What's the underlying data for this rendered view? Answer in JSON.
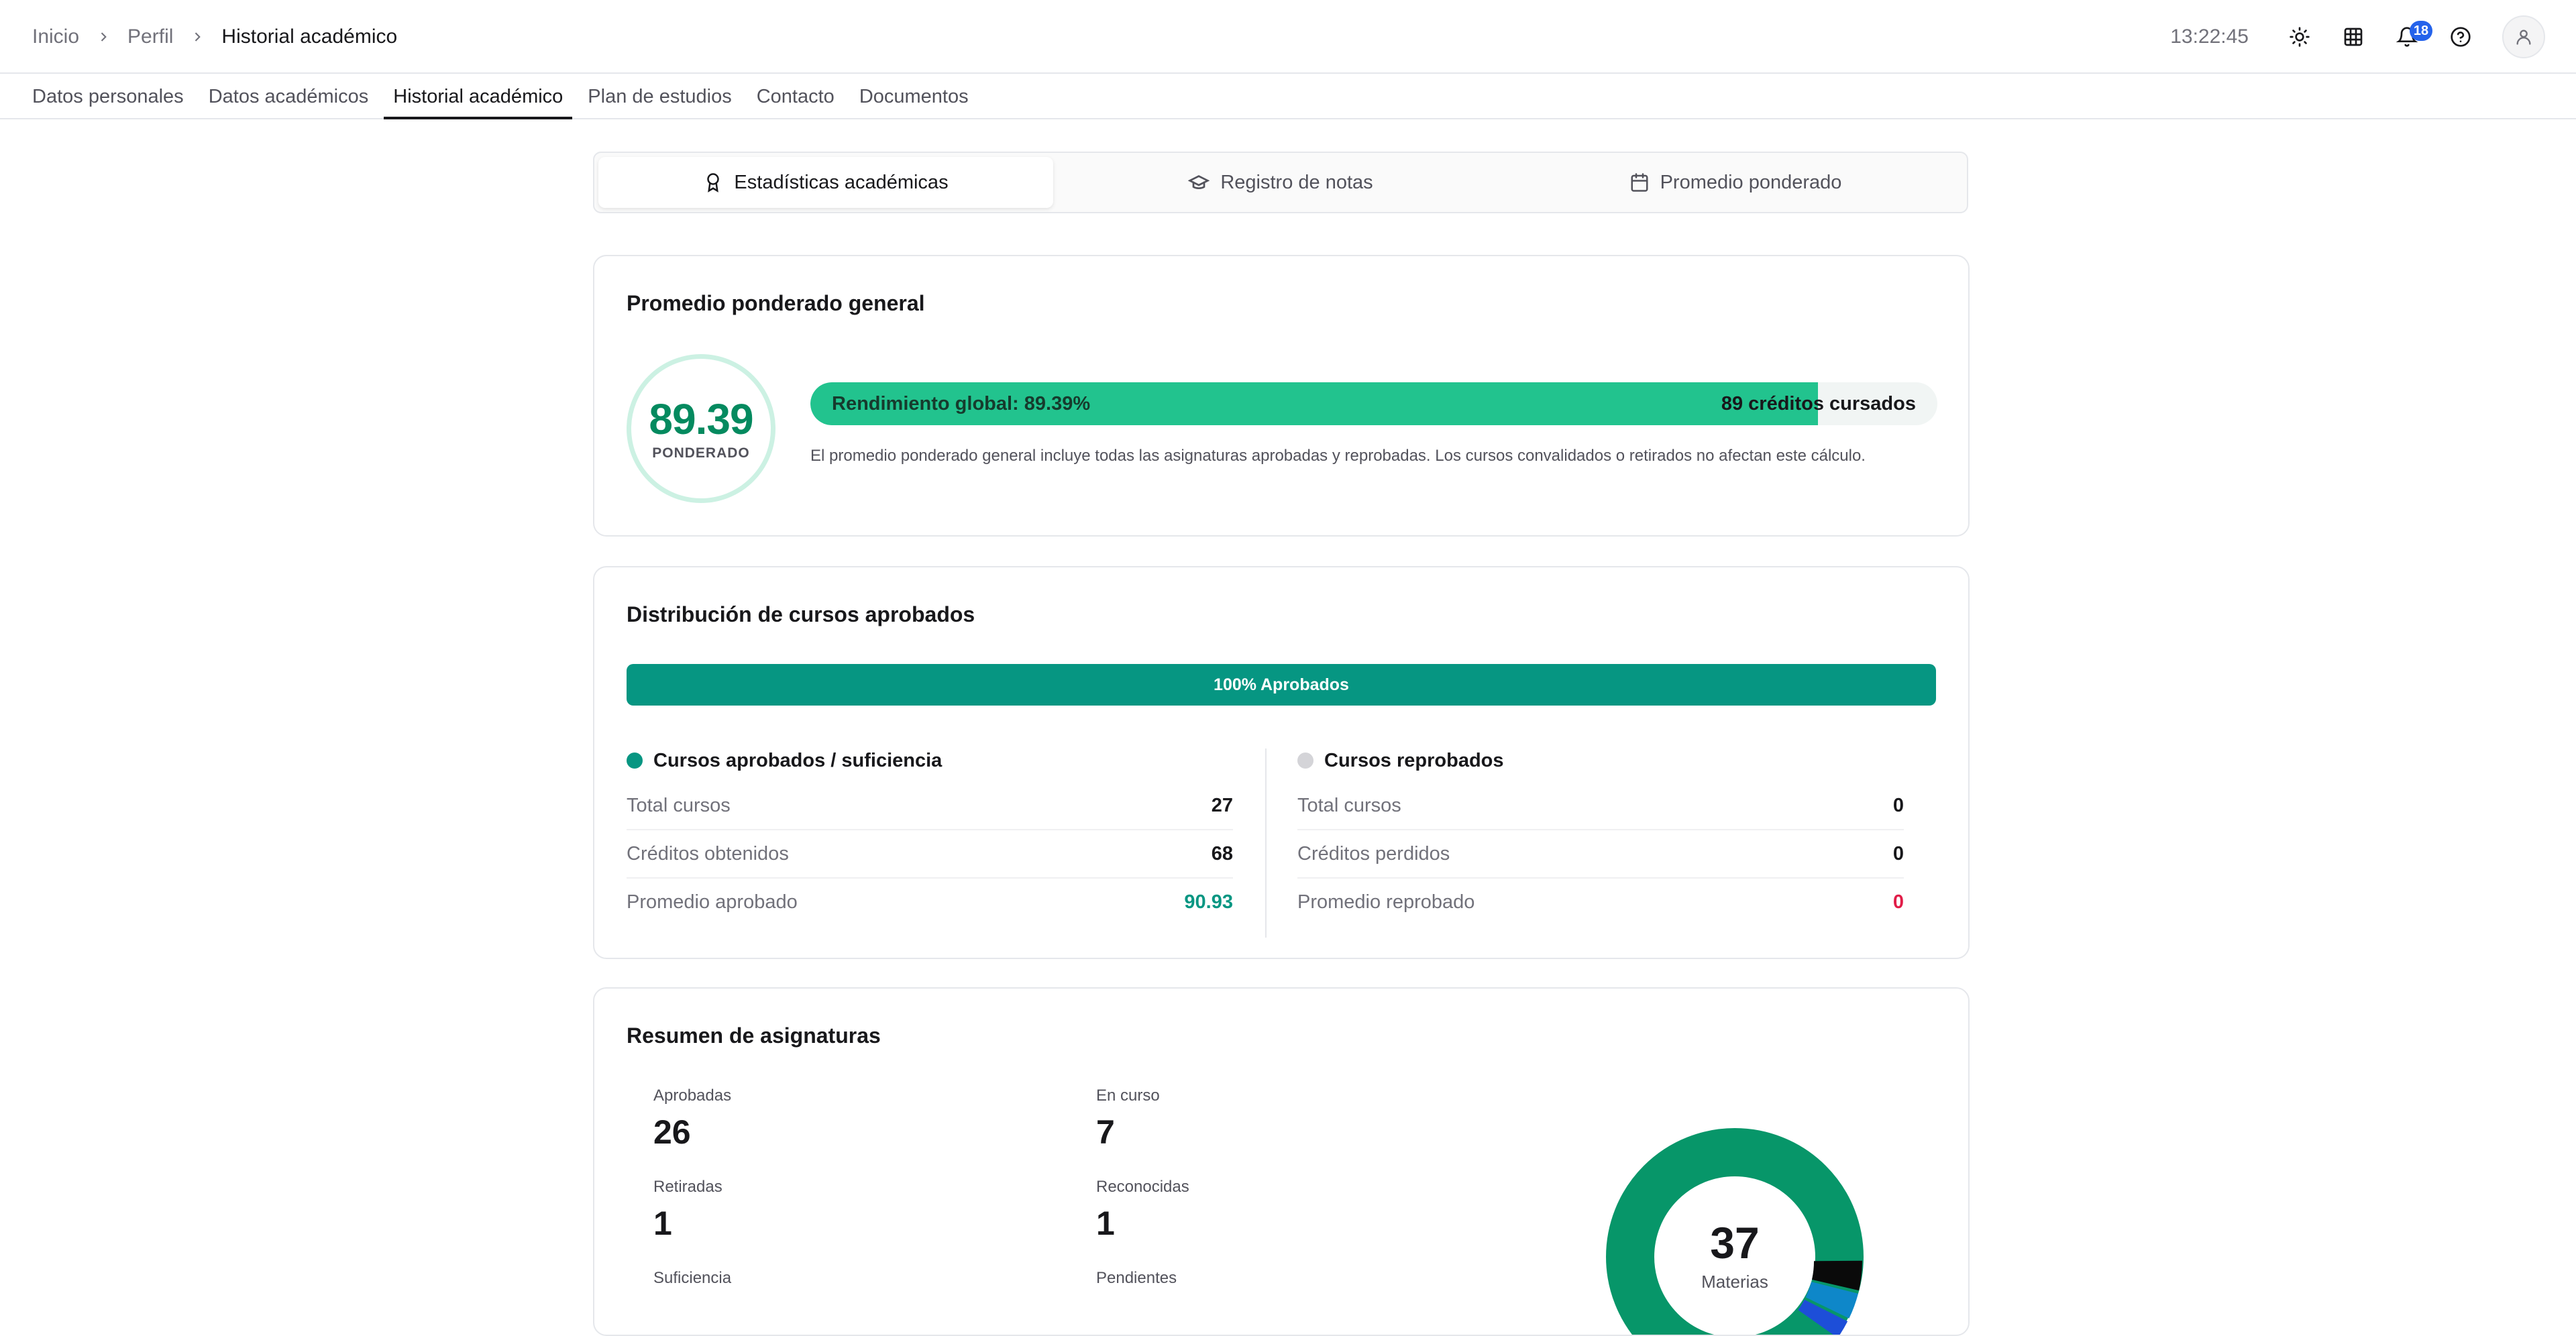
{
  "breadcrumb": {
    "items": [
      "Inicio",
      "Perfil",
      "Historial académico"
    ]
  },
  "header": {
    "clock": "13:22:45",
    "notifications_count": "18"
  },
  "tabs": [
    "Datos personales",
    "Datos académicos",
    "Historial académico",
    "Plan de estudios",
    "Contacto",
    "Documentos"
  ],
  "active_tab": "Historial académico",
  "segments": {
    "stats": "Estadísticas académicas",
    "grades": "Registro de notas",
    "average": "Promedio ponderado"
  },
  "weighted_card": {
    "title": "Promedio ponderado general",
    "score": "89.39",
    "score_label": "PONDERADO",
    "progress_text": "Rendimiento global: 89.39%",
    "progress_fraction": 0.8939,
    "credits_text": "89 créditos cursados",
    "note": "El promedio ponderado general incluye todas las asignaturas aprobadas y reprobadas. Los cursos convalidados o retirados no afectan este cálculo."
  },
  "distribution_card": {
    "title": "Distribución de cursos aprobados",
    "bar_label": "100% Aprobados",
    "approved": {
      "heading": "Cursos aprobados / suficiencia",
      "color": "#069682",
      "rows": [
        {
          "label": "Total cursos",
          "value": "27"
        },
        {
          "label": "Créditos obtenidos",
          "value": "68"
        },
        {
          "label": "Promedio aprobado",
          "value": "90.93"
        }
      ]
    },
    "failed": {
      "heading": "Cursos reprobados",
      "color": "#d4d4d8",
      "rows": [
        {
          "label": "Total cursos",
          "value": "0"
        },
        {
          "label": "Créditos perdidos",
          "value": "0"
        },
        {
          "label": "Promedio reprobado",
          "value": "0"
        }
      ]
    }
  },
  "summary_card": {
    "title": "Resumen de asignaturas",
    "stats": [
      {
        "label": "Aprobadas",
        "value": "26"
      },
      {
        "label": "En curso",
        "value": "7"
      },
      {
        "label": "Retiradas",
        "value": "1"
      },
      {
        "label": "Reconocidas",
        "value": "1"
      },
      {
        "label": "Suficiencia",
        "value": ""
      },
      {
        "label": "Pendientes",
        "value": ""
      }
    ],
    "donut_total": "37",
    "donut_label": "Materias"
  },
  "colors": {
    "accent": "#069682",
    "success": "#22c38e",
    "danger": "#e11d48",
    "brand_blue": "#2563eb"
  }
}
